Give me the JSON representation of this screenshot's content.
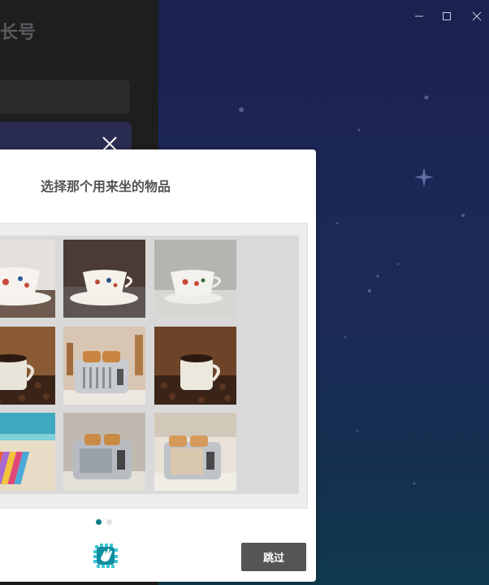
{
  "window": {
    "minimize_icon": "minimize-icon",
    "maximize_icon": "maximize-icon",
    "close_icon": "close-icon"
  },
  "background_panel": {
    "title_fragment": "长号"
  },
  "captcha": {
    "prompt": "选择那个用来坐的物品",
    "skip_label": "跳过",
    "accent_color": "#0e7c86",
    "pager": {
      "pages": 2,
      "current": 1
    },
    "tiles": [
      {
        "row": 1,
        "col": 1,
        "subject": "teacup"
      },
      {
        "row": 1,
        "col": 2,
        "subject": "teacup"
      },
      {
        "row": 1,
        "col": 3,
        "subject": "teacup"
      },
      {
        "row": 2,
        "col": 1,
        "subject": "coffee-mug"
      },
      {
        "row": 2,
        "col": 2,
        "subject": "toaster"
      },
      {
        "row": 2,
        "col": 3,
        "subject": "coffee-mug"
      },
      {
        "row": 3,
        "col": 1,
        "subject": "beach-towel"
      },
      {
        "row": 3,
        "col": 2,
        "subject": "toaster"
      },
      {
        "row": 3,
        "col": 3,
        "subject": "toaster"
      }
    ]
  }
}
